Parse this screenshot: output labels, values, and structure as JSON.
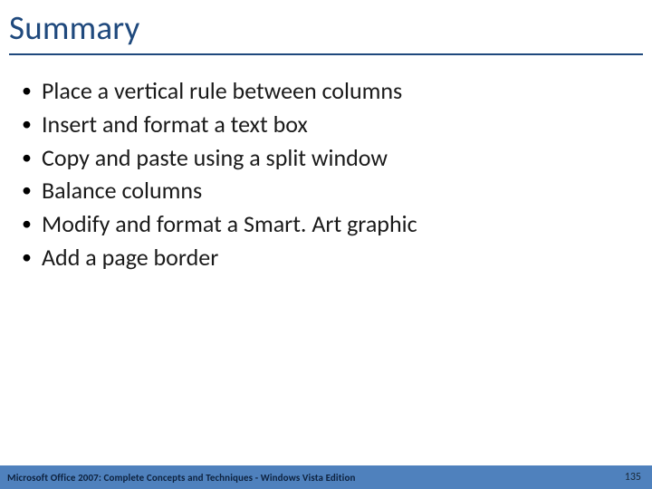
{
  "title": "Summary",
  "bullets": [
    "Place a vertical rule between columns",
    "Insert and format a text box",
    "Copy and paste using a split window",
    "Balance columns",
    "Modify and format a Smart. Art graphic",
    "Add a page border"
  ],
  "footer": {
    "left": "Microsoft Office 2007: Complete Concepts and Techniques - Windows Vista Edition",
    "page": "135"
  },
  "colors": {
    "heading": "#1f497d",
    "footer_bg": "#4f81bd"
  }
}
